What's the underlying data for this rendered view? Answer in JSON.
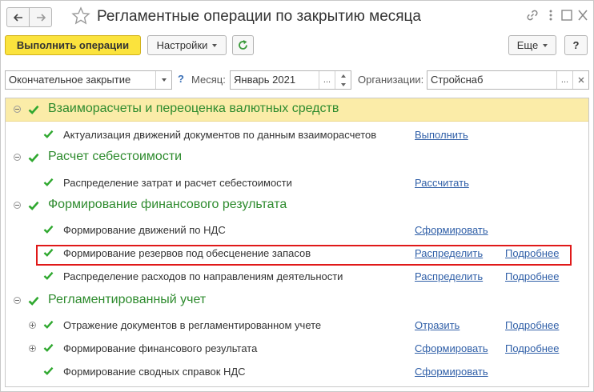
{
  "window": {
    "title": "Регламентные операции по закрытию месяца"
  },
  "toolbar": {
    "run_label": "Выполнить операции",
    "settings_label": "Настройки",
    "more_label": "Еще",
    "help_label": "?"
  },
  "filters": {
    "mode_value": "Окончательное закрытие",
    "help_mark": "?",
    "month_label": "Месяц:",
    "month_value": "Январь 2021",
    "org_label": "Организации:",
    "org_value": "Стройснаб",
    "ellipsis": "..."
  },
  "groups": [
    {
      "label": "Взаиморасчеты и переоценка валютных средств"
    },
    {
      "label": "Расчет себестоимости"
    },
    {
      "label": "Формирование финансового результата"
    },
    {
      "label": "Регламентированный учет"
    }
  ],
  "operations": [
    {
      "label": "Актуализация движений документов по данным взаиморасчетов",
      "action": "Выполнить",
      "details": ""
    },
    {
      "label": "Распределение затрат и расчет себестоимости",
      "action": "Рассчитать",
      "details": ""
    },
    {
      "label": "Формирование движений по НДС",
      "action": "Сформировать",
      "details": ""
    },
    {
      "label": "Формирование резервов под обесценение запасов",
      "action": "Распределить",
      "details": "Подробнее"
    },
    {
      "label": "Распределение расходов по направлениям деятельности",
      "action": "Распределить",
      "details": "Подробнее"
    },
    {
      "label": "Отражение документов в регламентированном учете",
      "action": "Отразить",
      "details": "Подробнее"
    },
    {
      "label": "Формирование финансового результата",
      "action": "Сформировать",
      "details": "Подробнее"
    },
    {
      "label": "Формирование сводных справок НДС",
      "action": "Сформировать",
      "details": ""
    }
  ],
  "colors": {
    "accent_button": "#fbe33d",
    "group_text": "#2e8b2e",
    "check": "#2fa82f",
    "link": "#3160a8",
    "selected_row": "#fbeca8",
    "highlight_frame": "#e01919"
  }
}
